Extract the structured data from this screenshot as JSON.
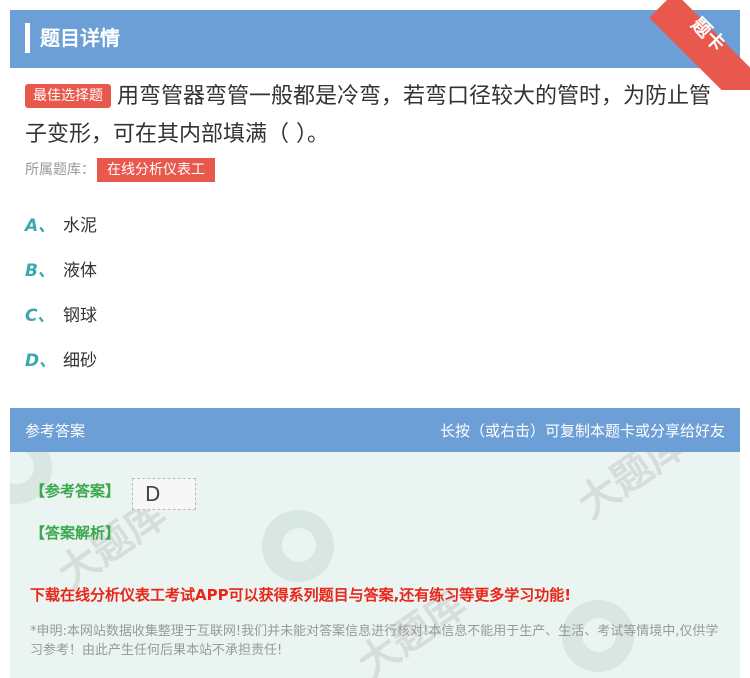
{
  "header": {
    "title": "题目详情",
    "ribbon_label": "题卡"
  },
  "question": {
    "tag": "最佳选择题",
    "text": "用弯管器弯管一般都是冷弯，若弯口径较大的管时，为防止管子变形，可在其内部填满（ ）。",
    "bank_label": "所属题库：",
    "bank_name": "在线分析仪表工"
  },
  "options": [
    {
      "key": "A、",
      "text": "水泥"
    },
    {
      "key": "B、",
      "text": "液体"
    },
    {
      "key": "C、",
      "text": "钢球"
    },
    {
      "key": "D、",
      "text": "细砂"
    }
  ],
  "answer": {
    "section_title": "参考答案",
    "share_hint": "长按（或右击）可复制本题卡或分享给好友",
    "ref_label": "【参考答案】",
    "ref_value": "D",
    "analysis_label": "【答案解析】",
    "promo": "下载在线分析仪表工考试APP可以获得系列题目与答案,还有练习等更多学习功能!",
    "disclaimer": "*申明:本网站数据收集整理于互联网!我们并未能对答案信息进行核对!本信息不能用于生产、生活、考试等情境中,仅供学习参考！由此产生任何后果本站不承担责任!"
  },
  "colors": {
    "header_bg": "#6c9fd5",
    "accent_red": "#e9584c",
    "option_key": "#3aa8ae",
    "answer_bg": "#eaf4f1",
    "label_green": "#3aa84c",
    "promo_red": "#e8261a"
  }
}
